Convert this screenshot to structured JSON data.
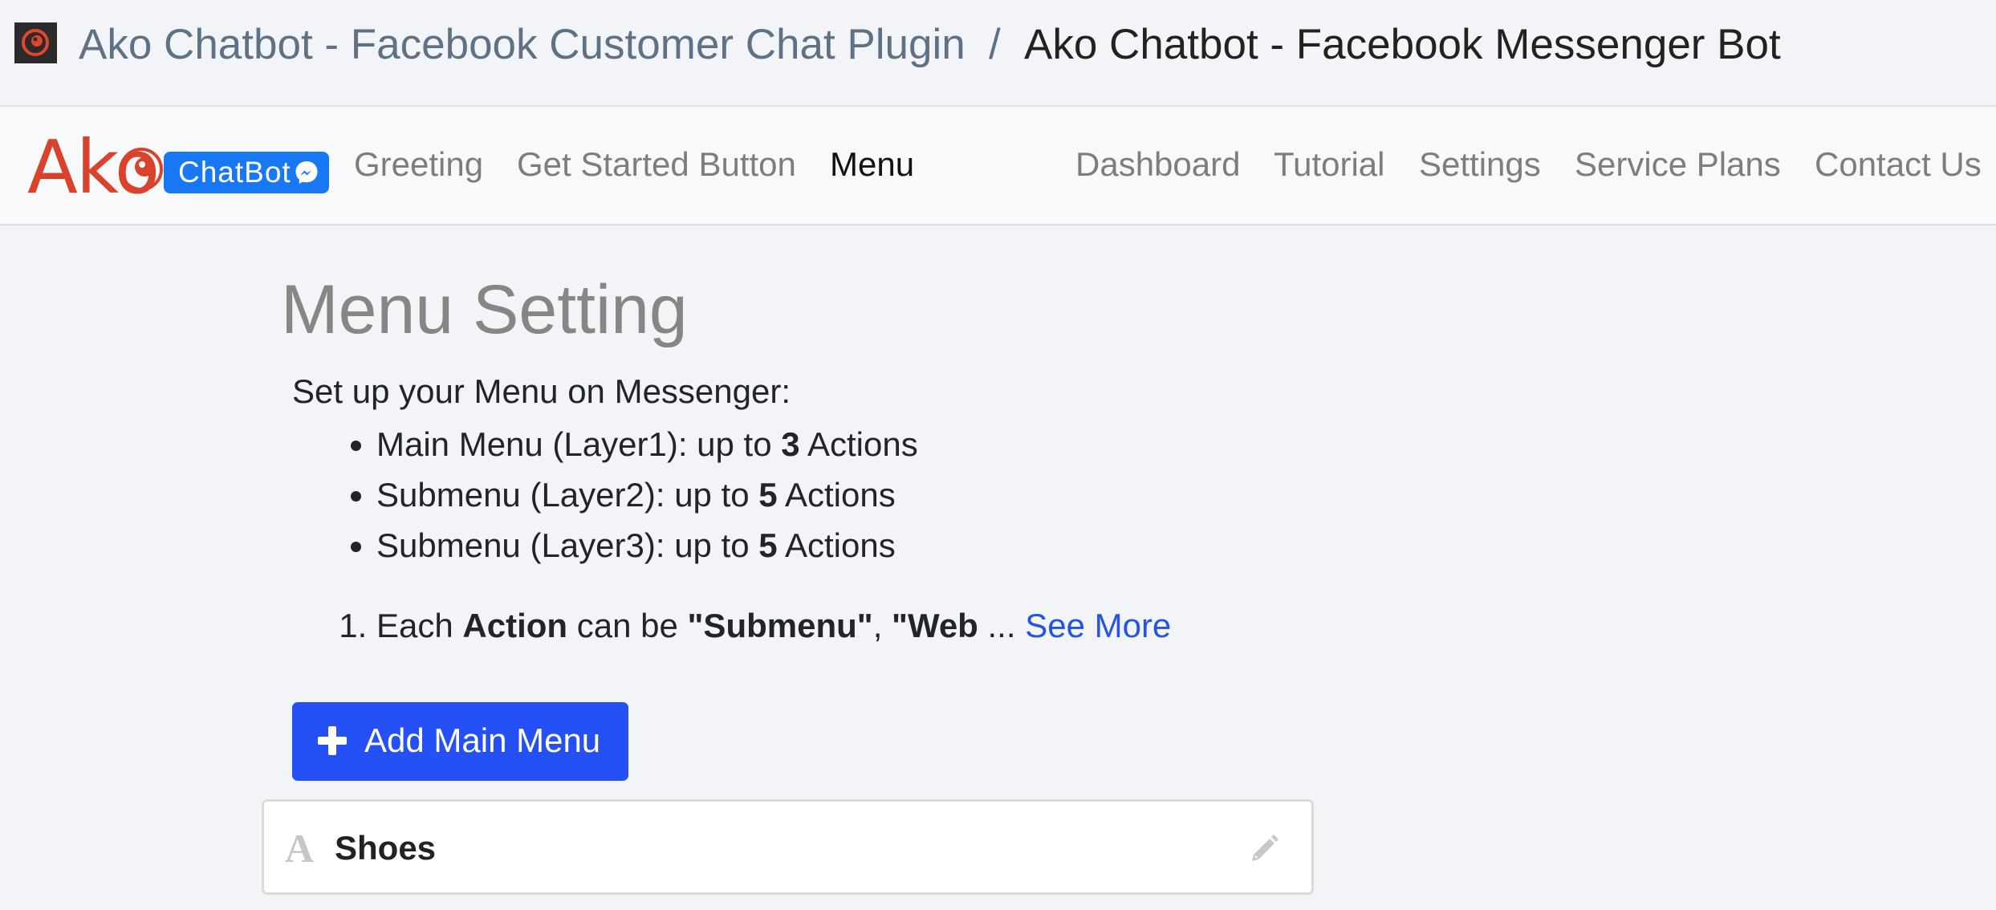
{
  "breadcrumb": {
    "parent": "Ako Chatbot - Facebook Customer Chat Plugin",
    "separator": "/",
    "current": "Ako Chatbot - Facebook Messenger Bot"
  },
  "brand": {
    "name": "Ako",
    "badge": "ChatBot",
    "color": "#d9432c",
    "badge_color": "#1877f2"
  },
  "nav": {
    "left": [
      {
        "label": "Greeting",
        "active": false
      },
      {
        "label": "Get Started Button",
        "active": false
      },
      {
        "label": "Menu",
        "active": true
      }
    ],
    "right": [
      {
        "label": "Dashboard"
      },
      {
        "label": "Tutorial"
      },
      {
        "label": "Settings"
      },
      {
        "label": "Service Plans"
      },
      {
        "label": "Contact Us"
      }
    ]
  },
  "main": {
    "title": "Menu Setting",
    "intro": "Set up your Menu on Messenger:",
    "limits": [
      {
        "prefix": "Main Menu (Layer1): up to ",
        "count": "3",
        "suffix": " Actions"
      },
      {
        "prefix": "Submenu (Layer2): up to ",
        "count": "5",
        "suffix": " Actions"
      },
      {
        "prefix": "Submenu (Layer3): up to ",
        "count": "5",
        "suffix": " Actions"
      }
    ],
    "note": {
      "t1": "Each ",
      "b1": "Action",
      "t2": " can be ",
      "b2": "\"Submenu\"",
      "t3": ", ",
      "b3": "\"Web",
      "t4": " ... ",
      "link": "See More"
    },
    "add_button": "Add Main Menu",
    "menu_items": [
      {
        "name": "Shoes",
        "type_icon": "text-type-icon",
        "glyph": "A"
      }
    ]
  },
  "colors": {
    "primary": "#2550f5",
    "link": "#2255e6",
    "background": "#f3f4f8"
  }
}
